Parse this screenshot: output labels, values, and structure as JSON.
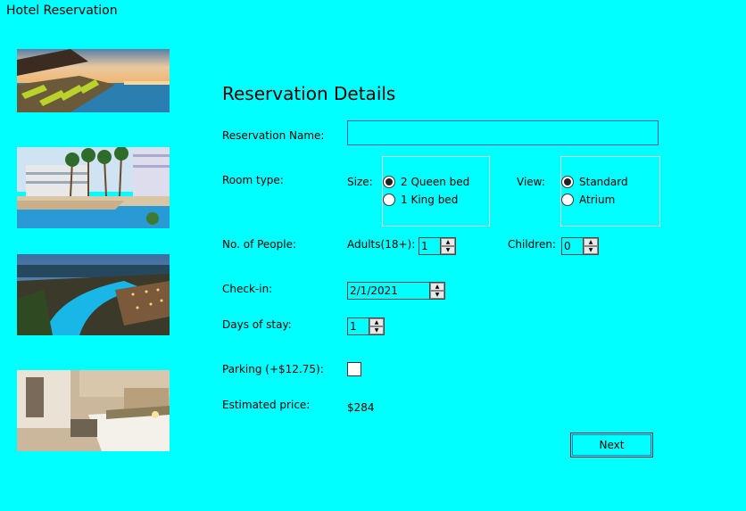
{
  "window": {
    "title": "Hotel Reservation"
  },
  "images": [
    {
      "name": "pool-lounge-photo"
    },
    {
      "name": "palm-pool-photo"
    },
    {
      "name": "resort-night-photo"
    },
    {
      "name": "hotel-room-photo"
    }
  ],
  "form": {
    "heading": "Reservation Details",
    "reservation_name": {
      "label": "Reservation Name:",
      "value": ""
    },
    "room_type": {
      "label": "Room type:",
      "size_label": "Size:",
      "size_options": [
        {
          "label": "2 Queen bed",
          "selected": true
        },
        {
          "label": "1 King bed",
          "selected": false
        }
      ],
      "view_label": "View:",
      "view_options": [
        {
          "label": "Standard",
          "selected": true
        },
        {
          "label": "Atrium",
          "selected": false
        }
      ]
    },
    "people": {
      "label": "No. of People:",
      "adults_label": "Adults(18+):",
      "adults_value": "1",
      "children_label": "Children:",
      "children_value": "0"
    },
    "checkin": {
      "label": "Check-in:",
      "value": "2/1/2021"
    },
    "days": {
      "label": "Days of stay:",
      "value": "1"
    },
    "parking": {
      "label": "Parking (+$12.75):",
      "checked": false
    },
    "estimate": {
      "label": "Estimated price:",
      "value": "$284"
    },
    "next_label": "Next"
  },
  "colors": {
    "background": "#00FFFF",
    "textbox_border": "#1e5aa8"
  }
}
